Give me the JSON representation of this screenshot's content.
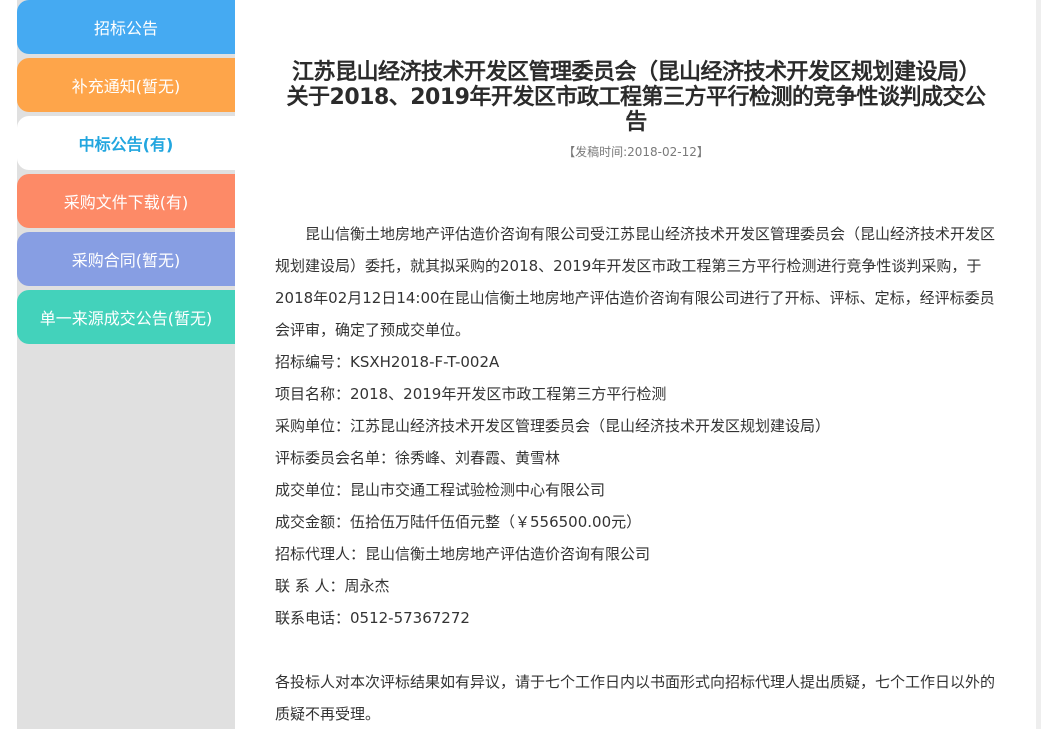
{
  "sidebar": {
    "items": [
      {
        "label": "招标公告",
        "color": "#45aaf2"
      },
      {
        "label": "补充通知(暂无)",
        "color": "#fea54a"
      },
      {
        "label": "中标公告(有)",
        "color": "#ffffff",
        "active": true
      },
      {
        "label": "采购文件下载(有)",
        "color": "#fd8a67"
      },
      {
        "label": "采购合同(暂无)",
        "color": "#879ee3"
      },
      {
        "label": "单一来源成交公告(暂无)",
        "color": "#43d2bb"
      }
    ]
  },
  "article": {
    "title_line1": "江苏昆山经济技术开发区管理委员会（昆山经济技术开发区规划建设局）",
    "title_line2": "关于2018、2019年开发区市政工程第三方平行检测的竞争性谈判成交公",
    "title_line3": "告",
    "date": "【发稿时间:2018-02-12】",
    "intro": "昆山信衡土地房地产评估造价咨询有限公司受江苏昆山经济技术开发区管理委员会（昆山经济技术开发区规划建设局）委托，就其拟采购的2018、2019年开发区市政工程第三方平行检测进行竞争性谈判采购，于2018年02月12日14:00在昆山信衡土地房地产评估造价咨询有限公司进行了开标、评标、定标，经评标委员会评审，确定了预成交单位。",
    "fields": [
      "招标编号：KSXH2018-F-T-002A",
      "项目名称：2018、2019年开发区市政工程第三方平行检测",
      "采购单位：江苏昆山经济技术开发区管理委员会（昆山经济技术开发区规划建设局）",
      "评标委员会名单：徐秀峰、刘春霞、黄雪林",
      "成交单位：昆山市交通工程试验检测中心有限公司",
      "成交金额：伍拾伍万陆仟伍佰元整（￥556500.00元）",
      "招标代理人：昆山信衡土地房地产评估造价咨询有限公司",
      "联 系 人：周永杰",
      "联系电话：0512-57367272"
    ],
    "closing": "各投标人对本次评标结果如有异议，请于七个工作日内以书面形式向招标代理人提出质疑，七个工作日以外的质疑不再受理。"
  }
}
